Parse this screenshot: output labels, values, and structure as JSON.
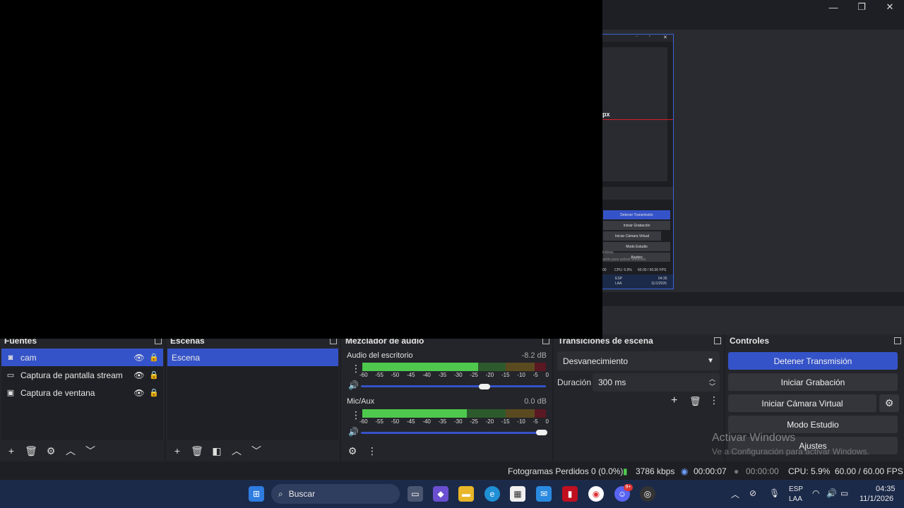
{
  "window_controls": {
    "minimize": "—",
    "maximize": "❐",
    "close": "✕"
  },
  "preview": {
    "label_px": "px",
    "mini": {
      "buttons": [
        "Detener Transmisión",
        "Iniciar Grabación",
        "Iniciar Cámara Virtual",
        "Modo Estudio",
        "Ajustes"
      ],
      "watermark_1": "indows",
      "watermark_2": "ación para activar Windows.",
      "status_cpu": "CPU: 5.9%",
      "status_fps": "60.00 / 60.00 FPS",
      "lang": "ESP",
      "lang2": "LAA",
      "time": "04:35",
      "date": "11/1/2026",
      "left_num": "00"
    }
  },
  "sources": {
    "title": "Fuentes",
    "items": [
      {
        "label": "cam",
        "icon": "camera-icon",
        "selected": true
      },
      {
        "label": "Captura de pantalla stream",
        "icon": "monitor-icon",
        "selected": false
      },
      {
        "label": "Captura de ventana",
        "icon": "window-icon",
        "selected": false
      }
    ]
  },
  "scenes": {
    "title": "Escenas",
    "items": [
      {
        "label": "Escena",
        "selected": true
      }
    ]
  },
  "mixer": {
    "title": "Mezclador de audio",
    "ticks": [
      "-60",
      "-55",
      "-50",
      "-45",
      "-40",
      "-35",
      "-30",
      "-25",
      "-20",
      "-15",
      "-10",
      "-5",
      "0"
    ],
    "channels": [
      {
        "name": "Audio del escritorio",
        "db": "-8.2 dB",
        "level": 0.63,
        "volume": 0.69
      },
      {
        "name": "Mic/Aux",
        "db": "0.0 dB",
        "level": 0.57,
        "volume": 1.0
      }
    ]
  },
  "transitions": {
    "title": "Transiciones de escena",
    "selected": "Desvanecimiento",
    "duration_label": "Duración",
    "duration_value": "300 ms"
  },
  "controls": {
    "title": "Controles",
    "buttons": {
      "stop_stream": "Detener Transmisión",
      "start_recording": "Iniciar Grabación",
      "start_virtual_cam": "Iniciar Cámara Virtual",
      "studio_mode": "Modo Estudio",
      "settings": "Ajustes"
    }
  },
  "watermark": {
    "line1": "Activar Windows",
    "line2": "Ve a Configuración para activar Windows."
  },
  "status": {
    "dropped_frames": "Fotogramas Perdidos 0 (0.0%)",
    "bitrate": "3786 kbps",
    "stream_time": "00:00:07",
    "rec_time": "00:00:00",
    "cpu": "CPU: 5.9%",
    "fps": "60.00 / 60.00 FPS"
  },
  "taskbar": {
    "search": "Buscar",
    "lang": "ESP",
    "lang2": "LAA",
    "time": "04:35",
    "date": "11/1/2026",
    "badge": "9+"
  },
  "colors": {
    "accent": "#3553c8",
    "meter_green": "#4ec94e",
    "meter_yellow": "#c7a23a",
    "meter_red": "#c0283a"
  }
}
